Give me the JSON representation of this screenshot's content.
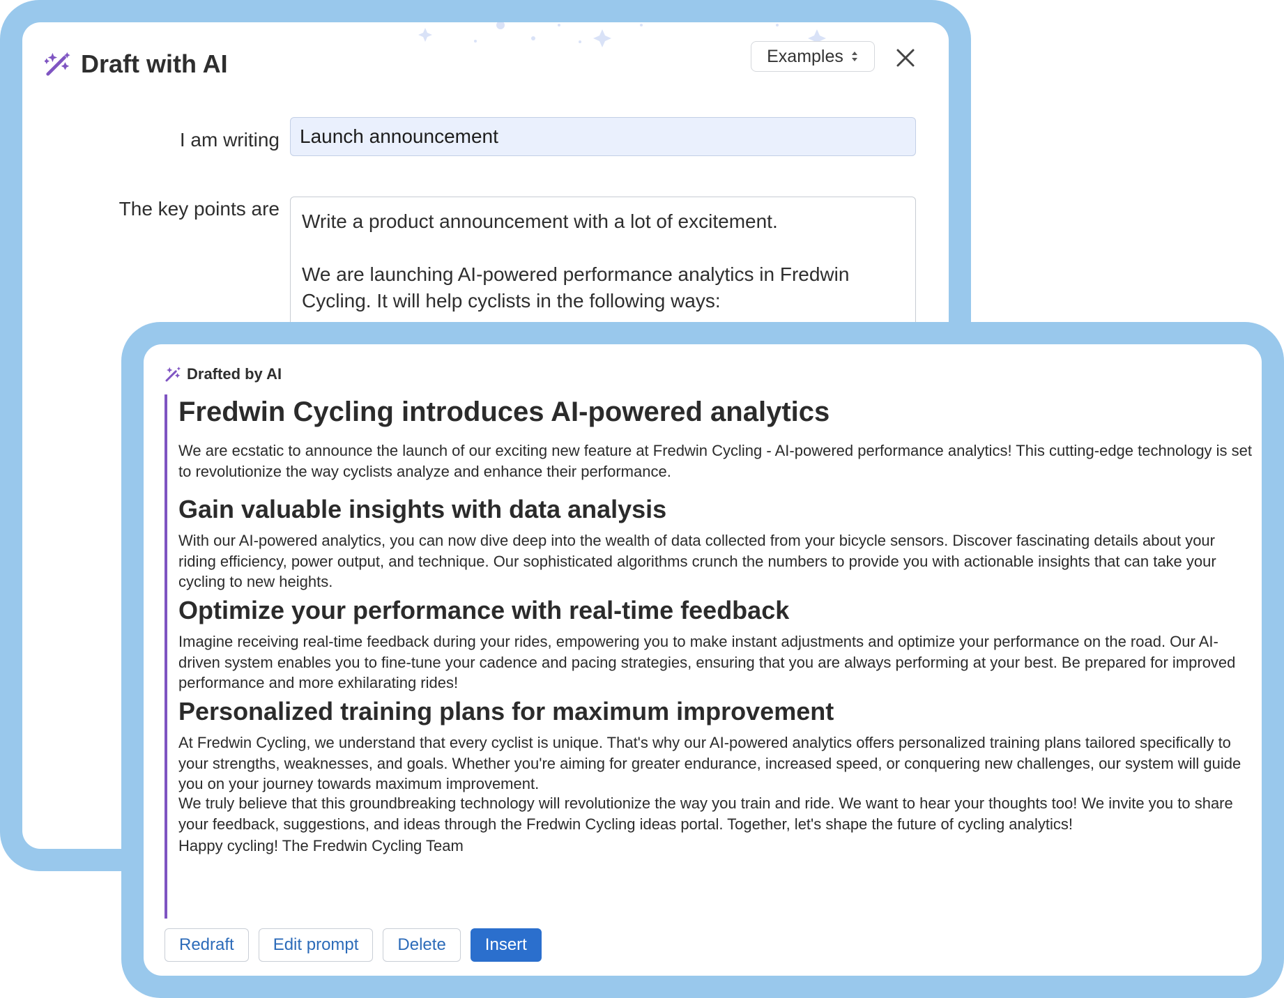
{
  "draft_dialog": {
    "title": "Draft with AI",
    "examples_label": "Examples",
    "writing_label": "I am writing",
    "writing_value": "Launch announcement",
    "keypoints_label": "The key points are",
    "keypoints_value": "Write a product announcement with a lot of excitement.\n\nWe are launching AI-powered performance analytics in Fredwin Cycling. It will help cyclists in the following ways:"
  },
  "draft_result": {
    "label": "Drafted by AI",
    "heading": "Fredwin Cycling introduces AI-powered analytics",
    "intro": "We are ecstatic to announce the launch of our exciting new feature at Fredwin Cycling - AI-powered performance analytics! This cutting-edge technology is set to revolutionize the way cyclists analyze and enhance their performance.",
    "sections": [
      {
        "heading": "Gain valuable insights with data analysis",
        "body": "With our AI-powered analytics, you can now dive deep into the wealth of data collected from your bicycle sensors. Discover fascinating details about your riding efficiency, power output, and technique. Our sophisticated algorithms crunch the numbers to provide you with actionable insights that can take your cycling to new heights."
      },
      {
        "heading": "Optimize your performance with real-time feedback",
        "body": "Imagine receiving real-time feedback during your rides, empowering you to make instant adjustments and optimize your performance on the road. Our AI-driven system enables you to fine-tune your cadence and pacing strategies, ensuring that you are always performing at your best. Be prepared for improved performance and more exhilarating rides!"
      },
      {
        "heading": "Personalized training plans for maximum improvement",
        "body": "At Fredwin Cycling, we understand that every cyclist is unique. That's why our AI-powered analytics offers personalized training plans tailored specifically to your strengths, weaknesses, and goals. Whether you're aiming for greater endurance, increased speed, or conquering new challenges, our system will guide you on your journey towards maximum improvement."
      }
    ],
    "closing": "We truly believe that this groundbreaking technology will revolutionize the way you train and ride. We want to hear your thoughts too! We invite you to share your feedback, suggestions, and ideas through the Fredwin Cycling ideas portal. Together, let's shape the future of cycling analytics!",
    "signoff": "Happy cycling! The Fredwin Cycling Team",
    "buttons": {
      "redraft": "Redraft",
      "edit_prompt": "Edit prompt",
      "delete": "Delete",
      "insert": "Insert"
    }
  },
  "colors": {
    "frame": "#99c8ec",
    "accent_purple": "#7f55c2",
    "primary_blue": "#2b6fcd",
    "input_bg": "#eaf0fd"
  },
  "icons": [
    "magic-wand-icon",
    "chevron-updown-icon",
    "close-icon"
  ]
}
